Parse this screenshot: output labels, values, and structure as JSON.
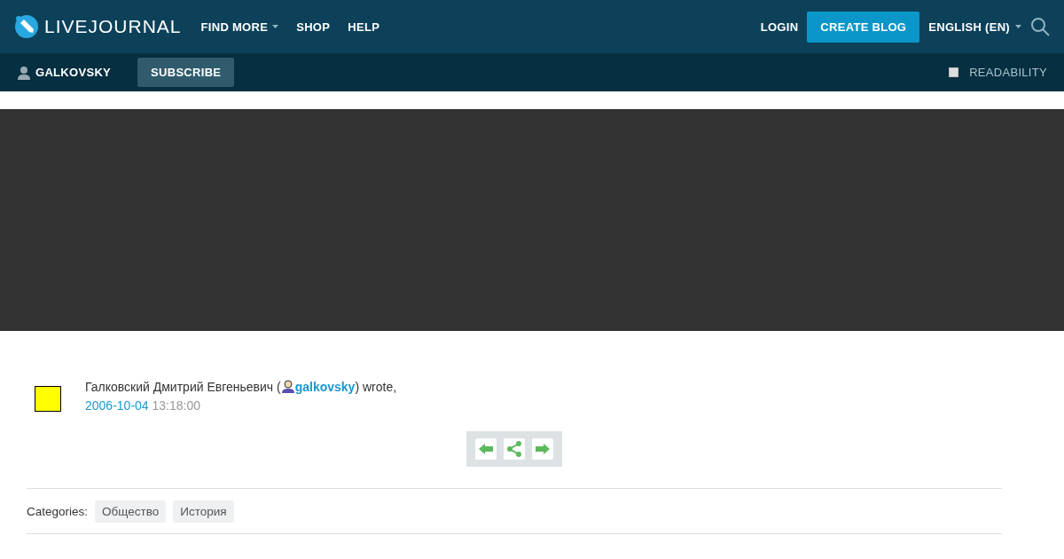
{
  "logo": {
    "text": "LIVEJOURNAL"
  },
  "nav": [
    {
      "label": "FIND MORE",
      "dropdown": true
    },
    {
      "label": "SHOP",
      "dropdown": false
    },
    {
      "label": "HELP",
      "dropdown": false
    }
  ],
  "login": "LOGIN",
  "create_blog": "CREATE BLOG",
  "language": {
    "label": "ENGLISH (EN)"
  },
  "journal_bar": {
    "username": "GALKOVSKY",
    "subscribe": "SUBSCRIBE",
    "readability": {
      "label": "READABILITY",
      "checked": false
    }
  },
  "entry": {
    "author_before": "Галковский Дмитрий Евгеньевич (",
    "username": "galkovsky",
    "author_after": ") wrote,",
    "date": "2006-10-04",
    "time": "13:18:00",
    "categories_label": "Categories:",
    "categories": [
      "Общество",
      "История"
    ]
  }
}
